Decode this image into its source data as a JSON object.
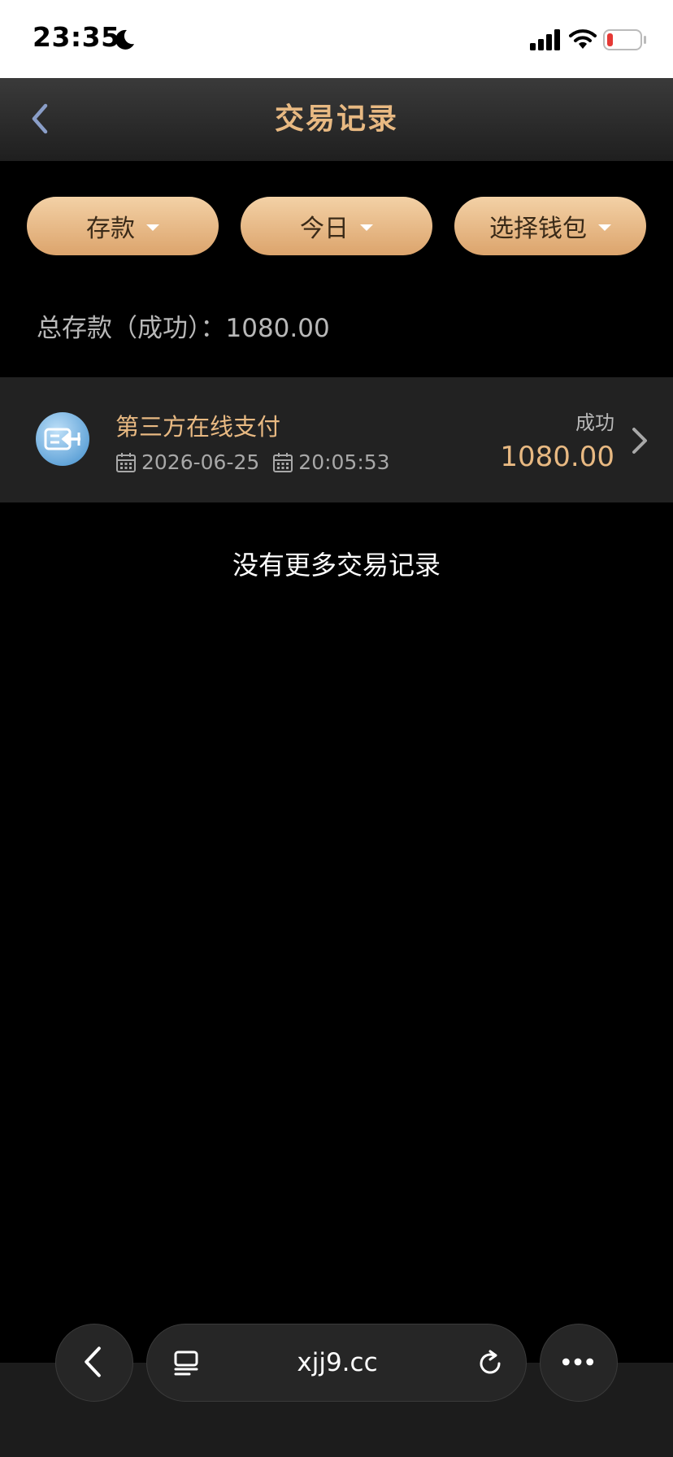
{
  "status_bar": {
    "time": "23:35"
  },
  "header": {
    "title": "交易记录"
  },
  "filters": {
    "type": "存款",
    "date": "今日",
    "wallet": "选择钱包"
  },
  "summary": {
    "text": "总存款（成功）：1080.00"
  },
  "transactions": [
    {
      "method": "第三方在线支付",
      "date": "2026-06-25",
      "time": "20:05:53",
      "status": "成功",
      "amount": "1080.00"
    }
  ],
  "list_end_text": "没有更多交易记录",
  "browser": {
    "url": "xjj9.cc"
  },
  "colors": {
    "accent": "#e8b982",
    "button_gold": "#dca46c",
    "background": "#000000",
    "row_bg": "#222222",
    "battery_low": "#e53935"
  }
}
